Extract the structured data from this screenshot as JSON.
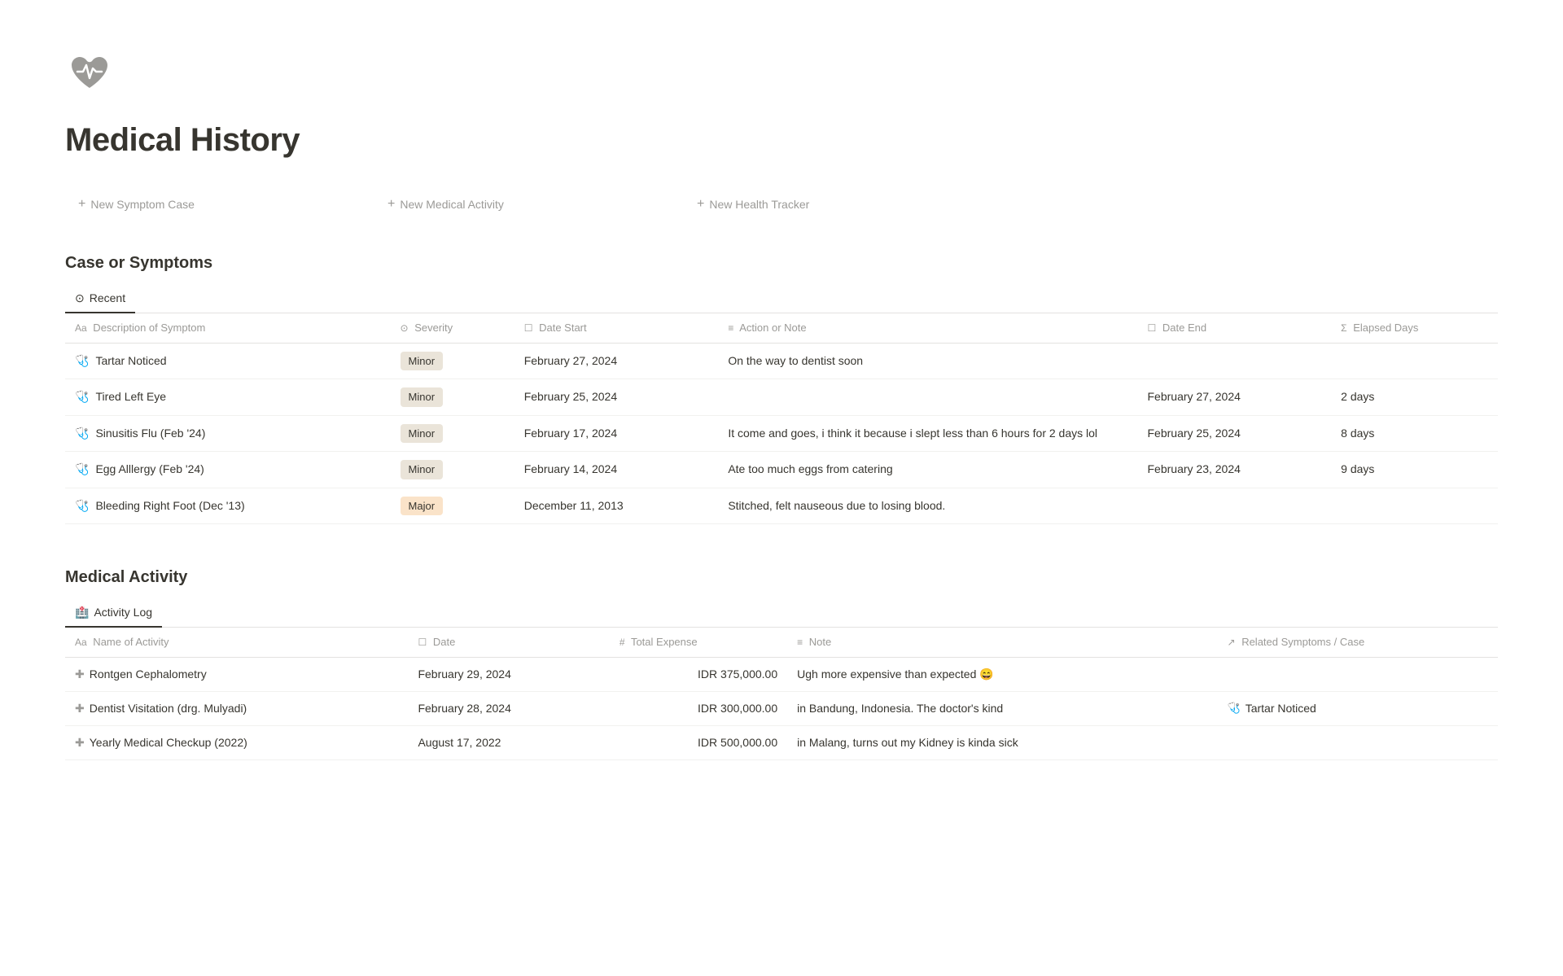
{
  "page": {
    "title": "Medical History",
    "icon_label": "heart-monitor-icon"
  },
  "actions": [
    {
      "label": "New Symptom Case",
      "id": "new-symptom-case"
    },
    {
      "label": "New Medical Activity",
      "id": "new-medical-activity"
    },
    {
      "label": "New Health Tracker",
      "id": "new-health-tracker"
    }
  ],
  "symptoms_section": {
    "title": "Case or Symptoms",
    "tab_icon": "⊙",
    "tab_label": "Recent",
    "columns": [
      {
        "icon": "Aa",
        "label": "Description of Symptom"
      },
      {
        "icon": "⊙",
        "label": "Severity"
      },
      {
        "icon": "☐",
        "label": "Date Start"
      },
      {
        "icon": "≡",
        "label": "Action or Note"
      },
      {
        "icon": "☐",
        "label": "Date End"
      },
      {
        "icon": "Σ",
        "label": "Elapsed Days"
      }
    ],
    "rows": [
      {
        "icon": "🩺",
        "name": "Tartar Noticed",
        "severity": "Minor",
        "severity_type": "minor",
        "date_start": "February 27, 2024",
        "note": "On the way to dentist soon",
        "date_end": "",
        "elapsed_days": ""
      },
      {
        "icon": "🩺",
        "name": "Tired Left Eye",
        "severity": "Minor",
        "severity_type": "minor",
        "date_start": "February 25, 2024",
        "note": "",
        "date_end": "February 27, 2024",
        "elapsed_days": "2 days"
      },
      {
        "icon": "🩺",
        "name": "Sinusitis Flu (Feb '24)",
        "severity": "Minor",
        "severity_type": "minor",
        "date_start": "February 17, 2024",
        "note": "It come and goes, i think it because i slept less than 6 hours for 2 days lol",
        "date_end": "February 25, 2024",
        "elapsed_days": "8 days"
      },
      {
        "icon": "🩺",
        "name": "Egg Alllergy (Feb '24)",
        "severity": "Minor",
        "severity_type": "minor",
        "date_start": "February 14, 2024",
        "note": "Ate too much eggs from catering",
        "date_end": "February 23, 2024",
        "elapsed_days": "9 days"
      },
      {
        "icon": "🩺",
        "name": "Bleeding Right Foot (Dec '13)",
        "severity": "Major",
        "severity_type": "major",
        "date_start": "December 11, 2013",
        "note": "Stitched, felt nauseous due to losing blood.",
        "date_end": "",
        "elapsed_days": ""
      }
    ]
  },
  "activity_section": {
    "title": "Medical Activity",
    "tab_icon": "🏥",
    "tab_label": "Activity Log",
    "columns": [
      {
        "icon": "Aa",
        "label": "Name of Activity"
      },
      {
        "icon": "☐",
        "label": "Date"
      },
      {
        "icon": "#",
        "label": "Total Expense"
      },
      {
        "icon": "≡",
        "label": "Note"
      },
      {
        "icon": "↗",
        "label": "Related Symptoms / Case"
      }
    ],
    "rows": [
      {
        "name": "Rontgen Cephalometry",
        "date": "February 29, 2024",
        "expense": "IDR 375,000.00",
        "note": "Ugh more expensive than expected 😄",
        "related": ""
      },
      {
        "name": "Dentist Visitation (drg. Mulyadi)",
        "date": "February 28, 2024",
        "expense": "IDR 300,000.00",
        "note": "in Bandung, Indonesia. The doctor's kind",
        "related": "Tartar Noticed"
      },
      {
        "name": "Yearly Medical Checkup (2022)",
        "date": "August 17, 2022",
        "expense": "IDR 500,000.00",
        "note": "in Malang, turns out my Kidney is kinda sick",
        "related": ""
      }
    ]
  }
}
